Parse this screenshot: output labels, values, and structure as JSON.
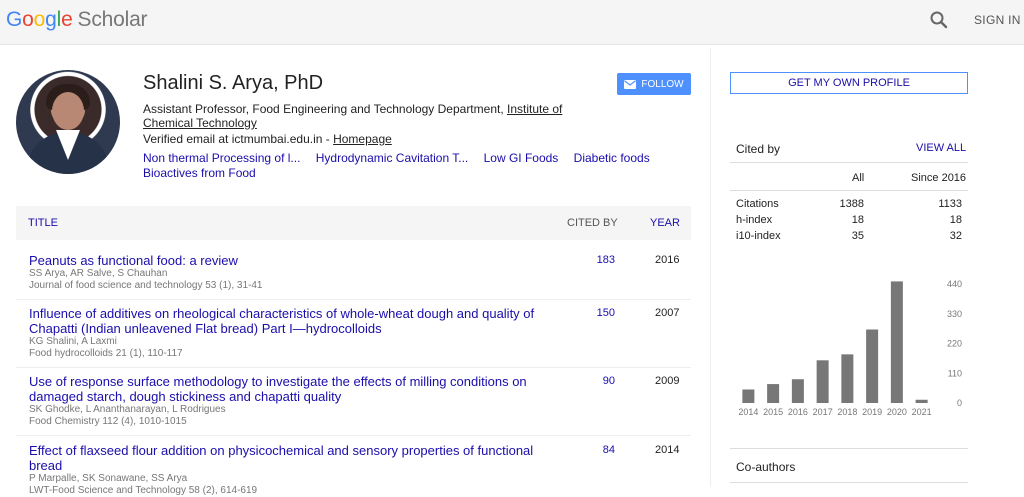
{
  "header": {
    "logo_g1": "G",
    "logo_o1": "o",
    "logo_o2": "o",
    "logo_g2": "g",
    "logo_l": "l",
    "logo_e": "e",
    "logo_scholar": "Scholar",
    "signin_label": "SIGN IN"
  },
  "profile": {
    "name": "Shalini S. Arya, PhD",
    "affiliation_prefix": "Assistant Professor, Food Engineering and Technology Department, ",
    "institution": "Institute of Chemical Technology",
    "verified_prefix": "Verified email at ictmumbai.edu.in - ",
    "homepage_label": "Homepage",
    "follow_label": "FOLLOW",
    "interests": [
      "Non thermal Processing of l...",
      "Hydrodynamic Cavitation T...",
      "Low GI Foods",
      "Diabetic foods",
      "Bioactives from Food"
    ]
  },
  "table": {
    "col_title": "TITLE",
    "col_cited_by": "CITED BY",
    "col_year": "YEAR",
    "articles": [
      {
        "title": "Peanuts as functional food: a review",
        "authors": "SS Arya, AR Salve, S Chauhan",
        "venue": "Journal of food science and technology 53 (1), 31-41",
        "cited_by": "183",
        "year": "2016"
      },
      {
        "title": "Influence of additives on rheological characteristics of whole-wheat dough and quality of Chapatti (Indian unleavened Flat bread) Part I—hydrocolloids",
        "authors": "KG Shalini, A Laxmi",
        "venue": "Food hydrocolloids 21 (1), 110-117",
        "cited_by": "150",
        "year": "2007"
      },
      {
        "title": "Use of response surface methodology to investigate the effects of milling conditions on damaged starch, dough stickiness and chapatti quality",
        "authors": "SK Ghodke, L Ananthanarayan, L Rodrigues",
        "venue": "Food Chemistry 112 (4), 1010-1015",
        "cited_by": "90",
        "year": "2009"
      },
      {
        "title": "Effect of flaxseed flour addition on physicochemical and sensory properties of functional bread",
        "authors": "P Marpalle, SK Sonawane, SS Arya",
        "venue": "LWT-Food Science and Technology 58 (2), 614-619",
        "cited_by": "84",
        "year": "2014"
      }
    ]
  },
  "sidebar": {
    "own_profile_label": "GET MY OWN PROFILE",
    "cited_by_title": "Cited by",
    "view_all_label": "VIEW ALL",
    "col_all": "All",
    "col_since": "Since 2016",
    "rows": [
      {
        "label": "Citations",
        "all": "1388",
        "since": "1133"
      },
      {
        "label": "h-index",
        "all": "18",
        "since": "18"
      },
      {
        "label": "i10-index",
        "all": "35",
        "since": "32"
      }
    ],
    "coauthors_title": "Co-authors"
  },
  "chart_data": {
    "type": "bar",
    "categories": [
      "2014",
      "2015",
      "2016",
      "2017",
      "2018",
      "2019",
      "2020",
      "2021"
    ],
    "values": [
      50,
      70,
      88,
      158,
      180,
      272,
      450,
      12
    ],
    "yticks": [
      0,
      110,
      220,
      330,
      440
    ],
    "ylim": [
      0,
      470
    ],
    "bar_color": "#777777"
  }
}
